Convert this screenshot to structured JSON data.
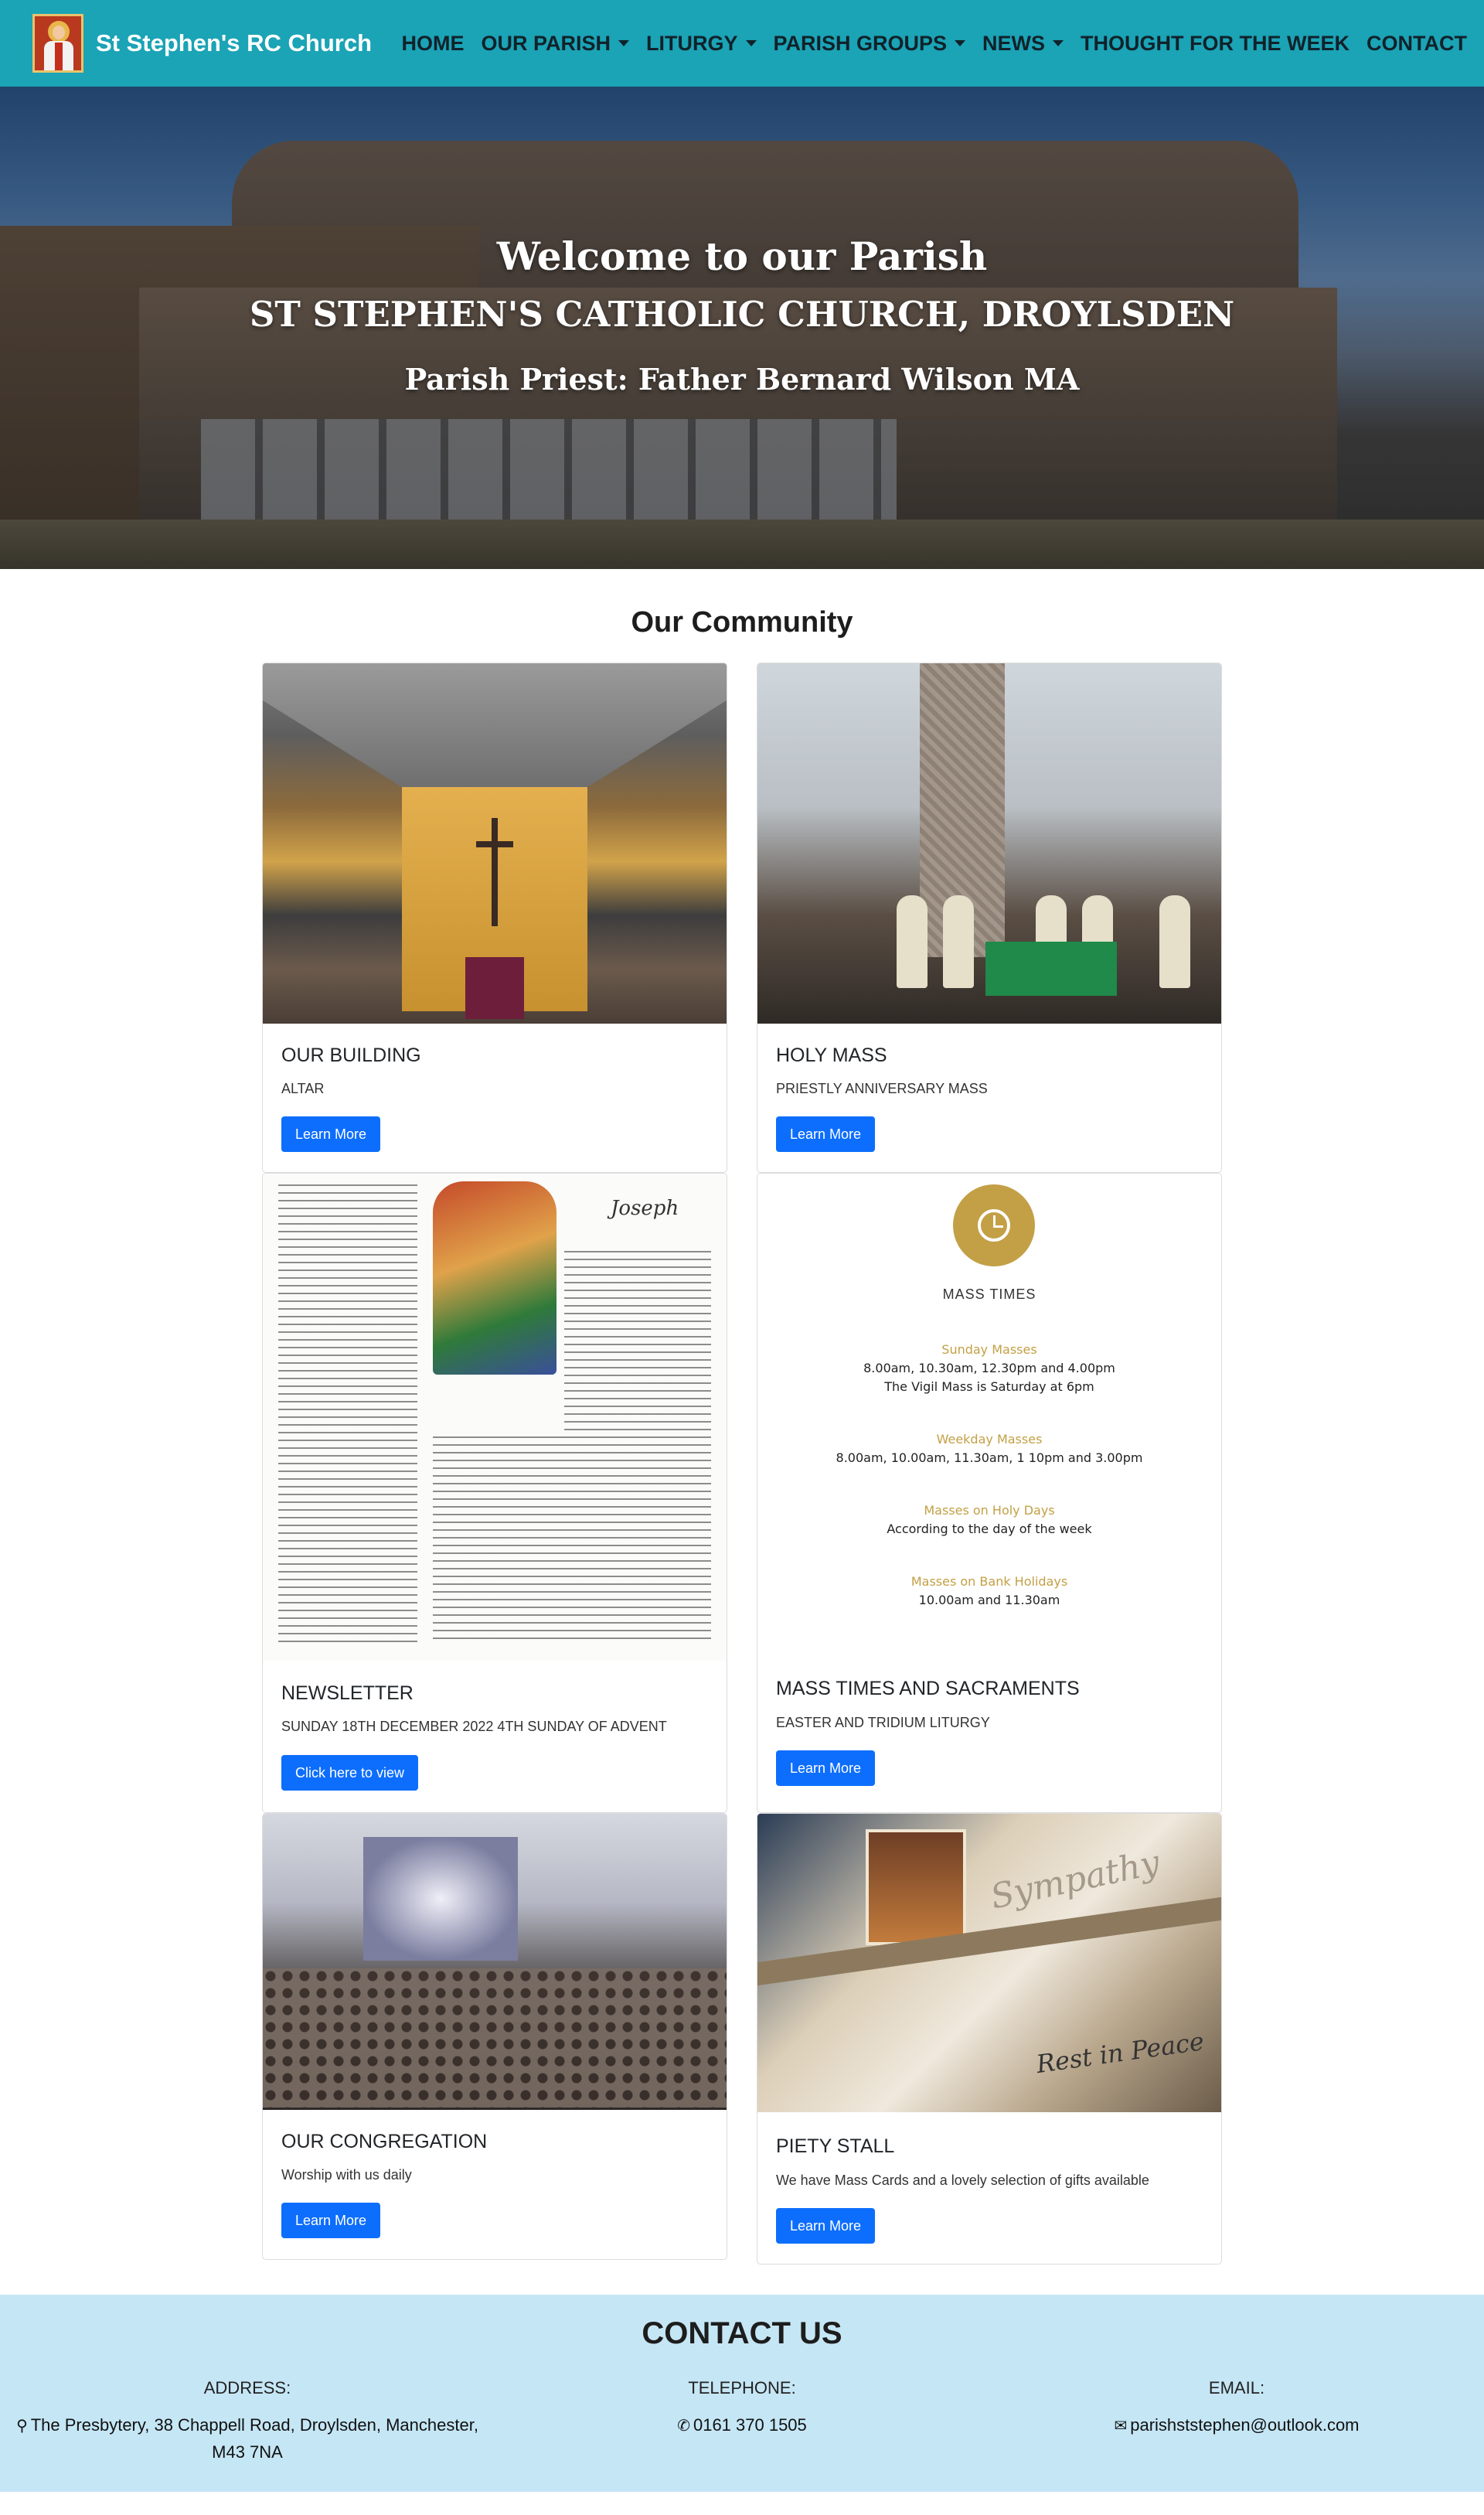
{
  "header": {
    "brand_name": "St Stephen's RC Church",
    "nav": [
      {
        "label": "HOME"
      },
      {
        "label": "OUR PARISH"
      },
      {
        "label": "LITURGY"
      },
      {
        "label": "PARISH GROUPS"
      },
      {
        "label": "NEWS"
      },
      {
        "label": "THOUGHT FOR THE WEEK"
      },
      {
        "label": "CONTACT"
      }
    ]
  },
  "hero": {
    "line1": "Welcome to our Parish",
    "line2": "ST STEPHEN'S CATHOLIC CHURCH, DROYLSDEN",
    "line3": "Parish Priest: Father Bernard Wilson MA"
  },
  "community": {
    "title": "Our Community",
    "cards": [
      {
        "title": "OUR BUILDING",
        "subtitle": "ALTAR",
        "button": "Learn More"
      },
      {
        "title": "HOLY MASS",
        "subtitle": "PRIESTLY ANNIVERSARY MASS",
        "button": "Learn More"
      },
      {
        "title": "NEWSLETTER",
        "subtitle": "SUNDAY 18TH DECEMBER 2022 4TH SUNDAY OF ADVENT",
        "button": "Click here to view"
      },
      {
        "title": "MASS TIMES AND SACRAMENTS",
        "subtitle": "EASTER AND TRIDIUM LITURGY",
        "button": "Learn More"
      },
      {
        "title": "OUR CONGREGATION",
        "subtitle": "Worship with us daily",
        "button": "Learn More"
      },
      {
        "title": "PIETY STALL",
        "subtitle": "We have Mass Cards and a lovely selection of gifts available",
        "button": "Learn More"
      }
    ],
    "newsletter_heading": "Joseph",
    "mass_times": {
      "heading": "MASS TIMES",
      "sunday_label": "Sunday Masses",
      "sunday_times": "8.00am, 10.30am, 12.30pm and 4.00pm",
      "sunday_vigil": "The Vigil Mass is Saturday at 6pm",
      "weekday_label": "Weekday Masses",
      "weekday_times": "8.00am, 10.00am, 11.30am, 1 10pm and 3.00pm",
      "holy_label": "Masses on Holy Days",
      "holy_times": "According to the day of the week",
      "bank_label": "Masses on Bank Holidays",
      "bank_times": "10.00am and 11.30am"
    },
    "piety_script_1": "Sympathy",
    "piety_script_2": "Rest in Peace"
  },
  "contact": {
    "title": "CONTACT US",
    "address_label": "ADDRESS:",
    "address_line1": "The Presbytery, 38 Chappell Road, Droylsden, Manchester,",
    "address_line2": "M43 7NA",
    "telephone_label": "TELEPHONE:",
    "telephone": "0161 370 1505",
    "email_label": "EMAIL:",
    "email": "parishststephen@outlook.com"
  }
}
